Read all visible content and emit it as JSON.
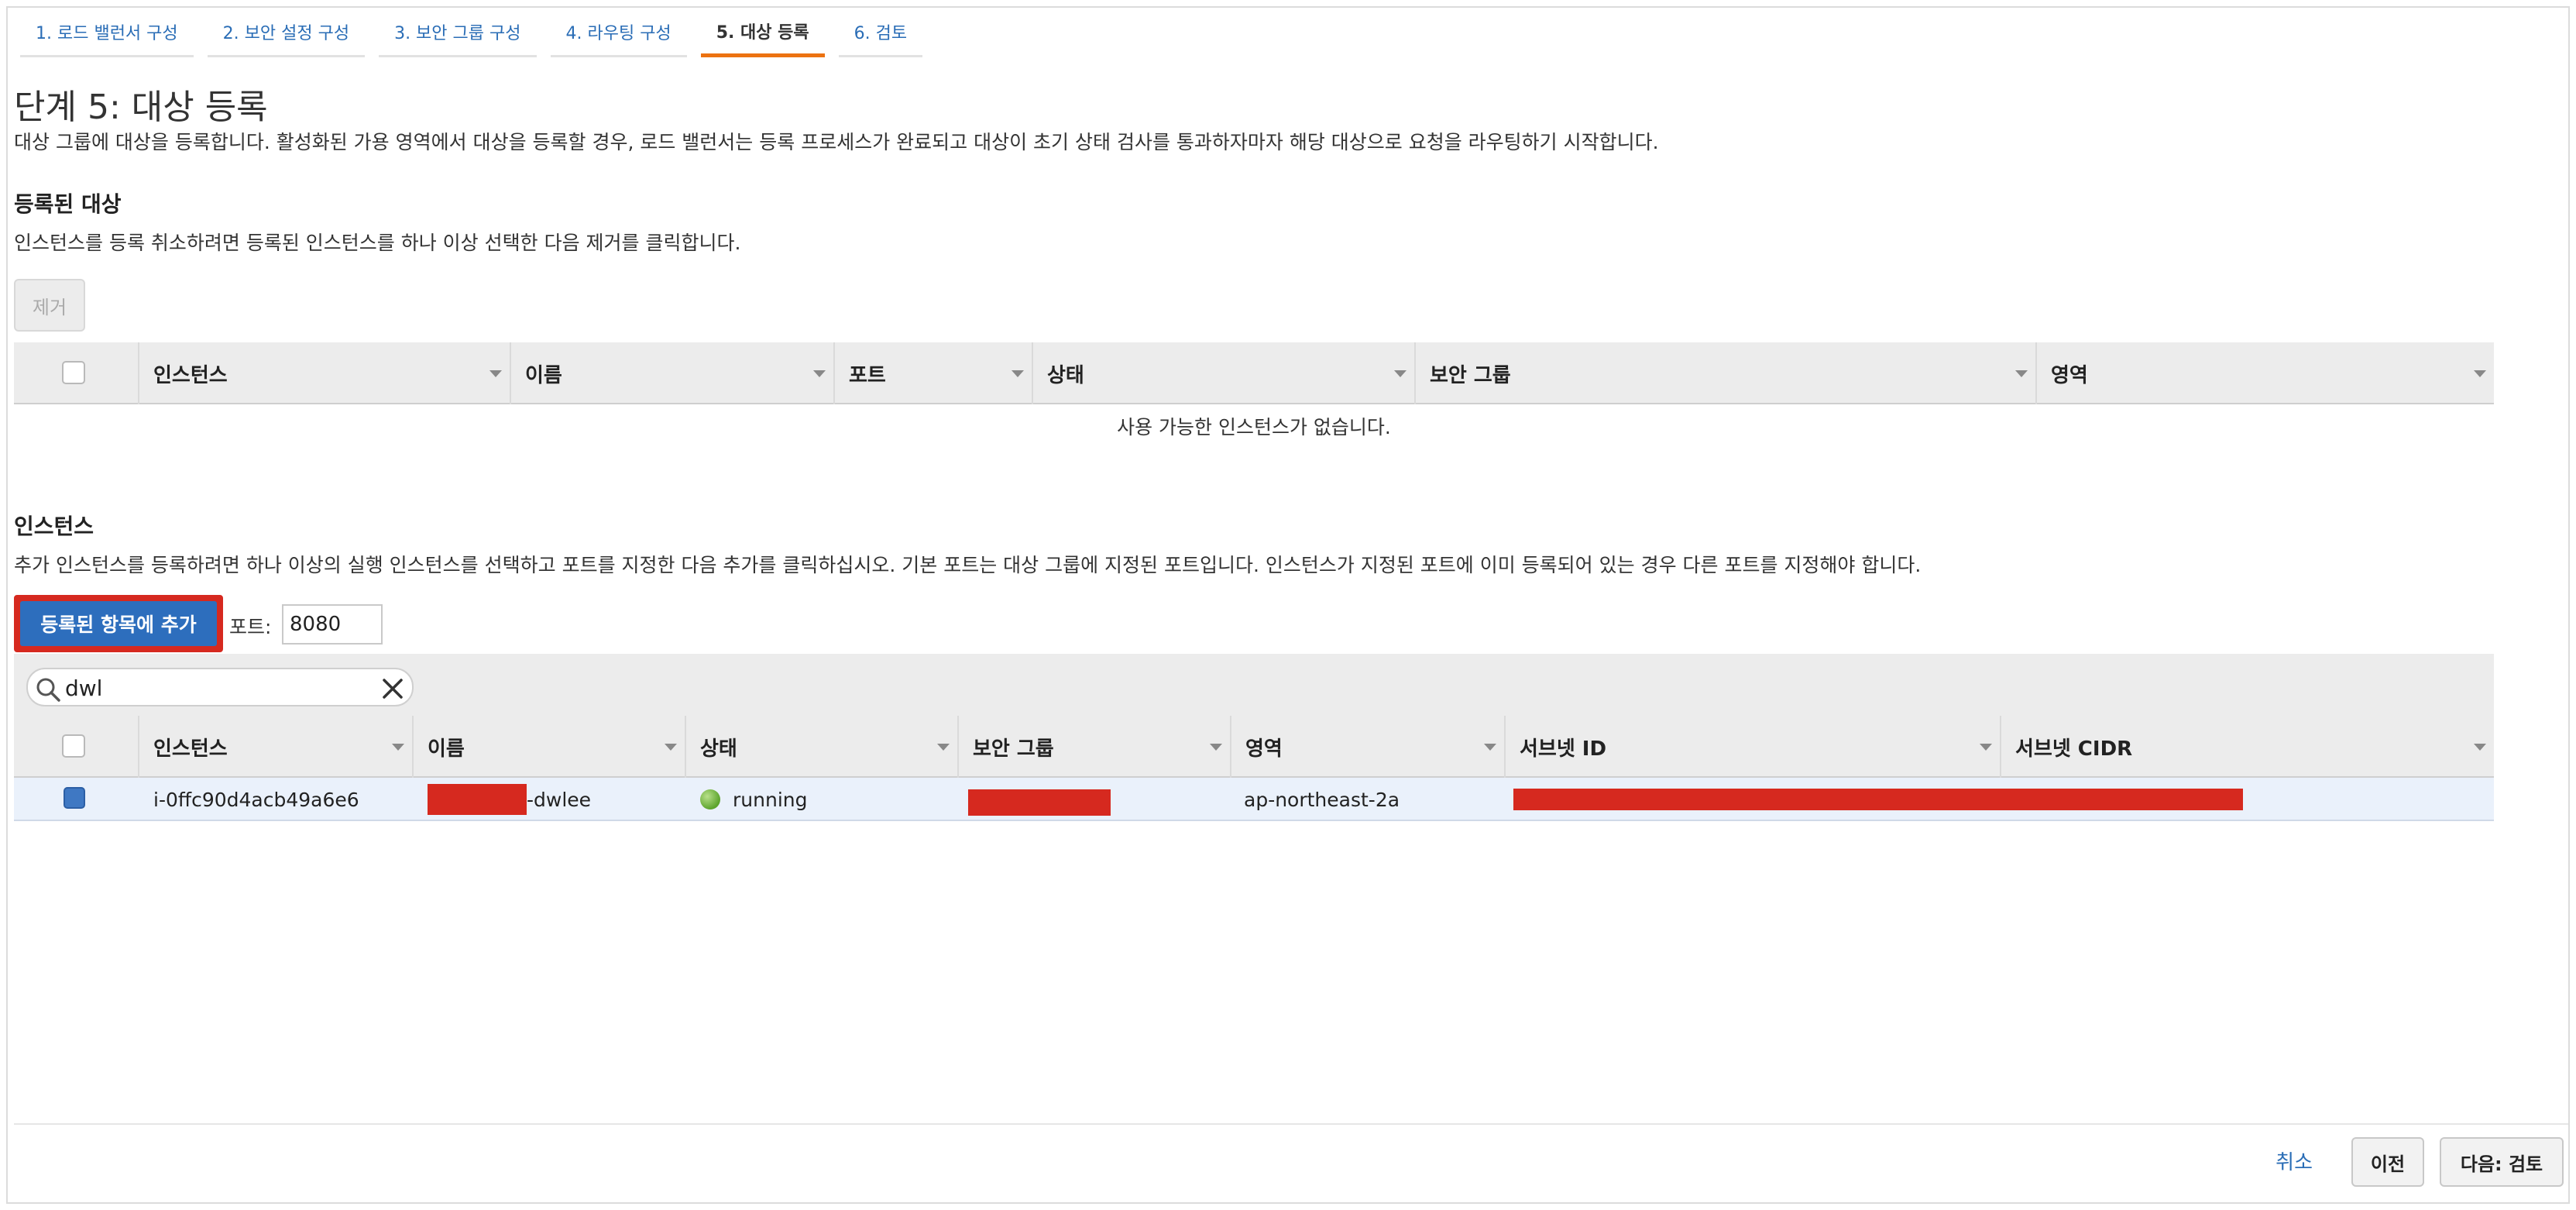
{
  "tabs": [
    {
      "label": "1. 로드 밸런서 구성",
      "active": false
    },
    {
      "label": "2. 보안 설정 구성",
      "active": false
    },
    {
      "label": "3. 보안 그룹 구성",
      "active": false
    },
    {
      "label": "4. 라우팅 구성",
      "active": false
    },
    {
      "label": "5. 대상 등록",
      "active": true
    },
    {
      "label": "6. 검토",
      "active": false
    }
  ],
  "page": {
    "title": "단계 5: 대상 등록",
    "description": "대상 그룹에 대상을 등록합니다. 활성화된 가용 영역에서 대상을 등록할 경우, 로드 밸런서는 등록 프로세스가 완료되고 대상이 초기 상태 검사를 통과하자마자 해당 대상으로 요청을 라우팅하기 시작합니다."
  },
  "registered": {
    "title": "등록된 대상",
    "description": "인스턴스를 등록 취소하려면 등록된 인스턴스를 하나 이상 선택한 다음 제거를 클릭합니다.",
    "remove_label": "제거",
    "columns": [
      "인스턴스",
      "이름",
      "포트",
      "상태",
      "보안 그룹",
      "영역"
    ],
    "empty_message": "사용 가능한 인스턴스가 없습니다."
  },
  "instances": {
    "title": "인스턴스",
    "description": "추가 인스턴스를 등록하려면 하나 이상의 실행 인스턴스를 선택하고 포트를 지정한 다음 추가를 클릭하십시오. 기본 포트는 대상 그룹에 지정된 포트입니다. 인스턴스가 지정된 포트에 이미 등록되어 있는 경우 다른 포트를 지정해야 합니다.",
    "add_label": "등록된 항목에 추가",
    "port_label": "포트:",
    "port_value": "8080",
    "search_value": "dwl",
    "columns": [
      "인스턴스",
      "이름",
      "상태",
      "보안 그룹",
      "영역",
      "서브넷 ID",
      "서브넷 CIDR"
    ],
    "rows": [
      {
        "instance_id": "i-0ffc90d4acb49a6e6",
        "name_suffix": "-dwlee",
        "state": "running",
        "zone": "ap-northeast-2a",
        "selected": true
      }
    ]
  },
  "footer": {
    "cancel_label": "취소",
    "prev_label": "이전",
    "next_label": "다음: 검토"
  },
  "colors": {
    "accent_tab": "#ec7211",
    "link": "#2a6db6",
    "primary_button": "#2d6ebd",
    "highlight_border": "#d6291f",
    "redaction": "#d6291f",
    "running": "#5ca42c"
  }
}
